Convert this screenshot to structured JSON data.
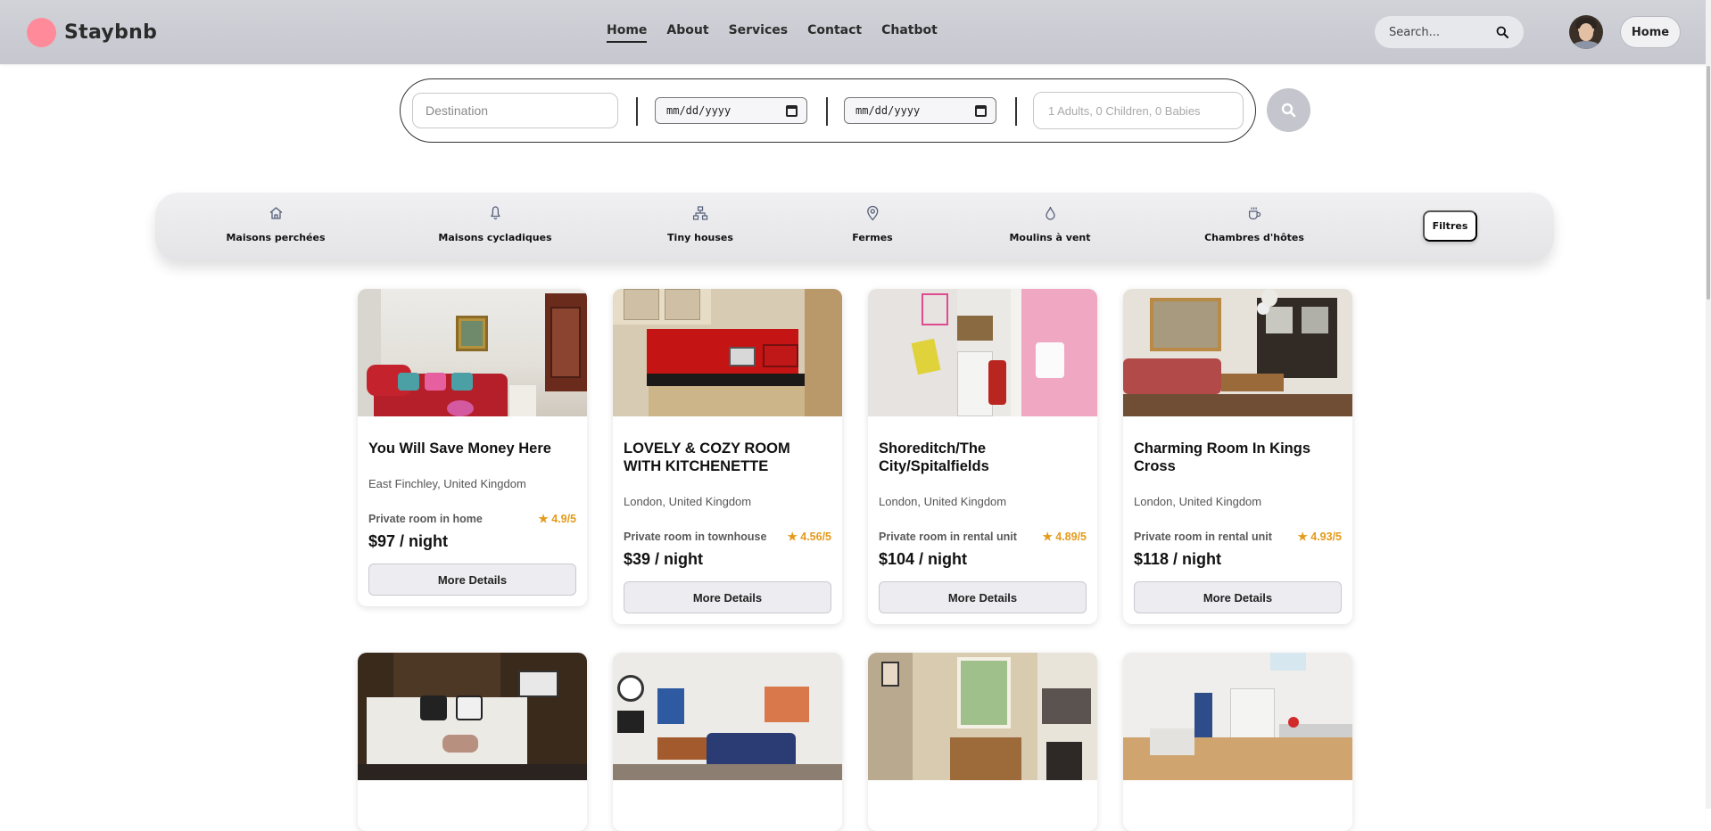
{
  "brand": {
    "name": "Staybnb",
    "accent": "#ff8a9a"
  },
  "nav": {
    "links": [
      "Home",
      "About",
      "Services",
      "Contact",
      "Chatbot"
    ],
    "active": "Home",
    "search_placeholder": "Search...",
    "home_button": "Home"
  },
  "booking": {
    "destination_placeholder": "Destination",
    "checkin": "mm/dd/yyyy",
    "checkout": "mm/dd/yyyy",
    "guests_placeholder": "1 Adults, 0 Children, 0 Babies"
  },
  "categories": {
    "items": [
      {
        "label": "Maisons perchées",
        "icon": "home-icon"
      },
      {
        "label": "Maisons cycladiques",
        "icon": "bell-icon"
      },
      {
        "label": "Tiny houses",
        "icon": "sitemap-icon"
      },
      {
        "label": "Fermes",
        "icon": "location-pin-icon"
      },
      {
        "label": "Moulins à vent",
        "icon": "droplet-icon"
      },
      {
        "label": "Chambres d'hôtes",
        "icon": "coffee-cup-icon"
      }
    ],
    "filter_label": "Filtres"
  },
  "listings": [
    {
      "title": "You Will Save Money Here",
      "location": "East Finchley, United Kingdom",
      "type": "Private room in home",
      "rating": "★ 4.9/5",
      "price": "$97 / night",
      "button": "More Details",
      "photo": "living-room-red-sofa"
    },
    {
      "title": "LOVELY & COZY ROOM WITH KITCHENETTE",
      "location": "London, United Kingdom",
      "type": "Private room in townhouse",
      "rating": "★ 4.56/5",
      "price": "$39 / night",
      "button": "More Details",
      "photo": "red-tile-kitchenette"
    },
    {
      "title": "Shoreditch/The City/Spitalfields",
      "location": "London, United Kingdom",
      "type": "Private room in rental unit",
      "rating": "★ 4.89/5",
      "price": "$104 / night",
      "button": "More Details",
      "photo": "small-kitchen-pink-bathroom"
    },
    {
      "title": "Charming Room In Kings Cross",
      "location": "London, United Kingdom",
      "type": "Private room in rental unit",
      "rating": "★ 4.93/5",
      "price": "$118 / night",
      "button": "More Details",
      "photo": "lounge-mirror-fireplace"
    },
    {
      "title": "",
      "location": "",
      "type": "",
      "rating": "",
      "price": "",
      "button": "",
      "photo": "bedroom-patterned-pillows"
    },
    {
      "title": "",
      "location": "",
      "type": "",
      "rating": "",
      "price": "",
      "button": "",
      "photo": "living-room-blue-sofa"
    },
    {
      "title": "",
      "location": "",
      "type": "",
      "rating": "",
      "price": "",
      "button": "",
      "photo": "dining-window-kitchen"
    },
    {
      "title": "",
      "location": "",
      "type": "",
      "rating": "",
      "price": "",
      "button": "",
      "photo": "open-white-kitchen"
    }
  ]
}
